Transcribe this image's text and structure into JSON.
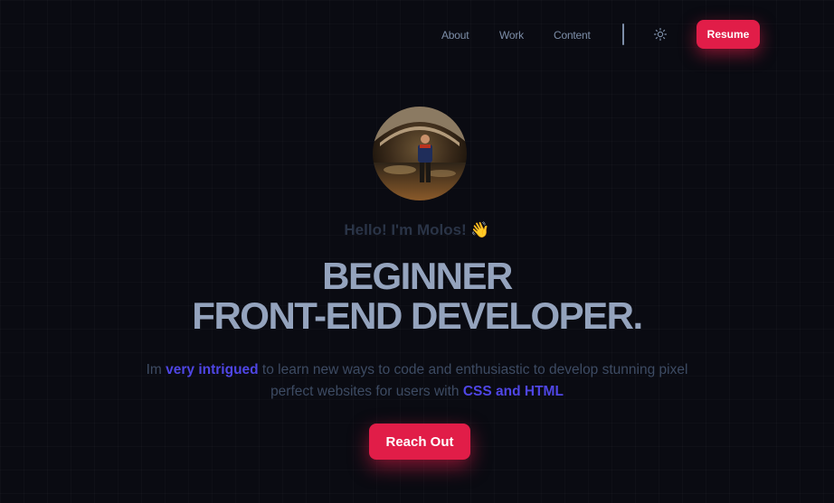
{
  "nav": {
    "items": [
      {
        "label": "About"
      },
      {
        "label": "Work"
      },
      {
        "label": "Content"
      }
    ],
    "theme_toggle_icon": "sun-icon",
    "resume_label": "Resume"
  },
  "hero": {
    "avatar_icon": "profile-photo",
    "greeting": "Hello! I'm Molos! 👋",
    "headline_line1": "BEGINNER",
    "headline_line2": "FRONT-END DEVELOPER.",
    "tagline": {
      "part1": "Im ",
      "highlight1": "very intrigued",
      "part2": " to learn new ways to code and enthusiastic to develop stunning pixel perfect websites for users with ",
      "highlight2": "CSS and HTML"
    },
    "cta_label": "Reach Out"
  },
  "colors": {
    "background": "#0a0b12",
    "accent": "#e11d48",
    "highlight": "#4f46e5",
    "headline": "#94a3bd",
    "nav_text": "#7d8ea8"
  }
}
